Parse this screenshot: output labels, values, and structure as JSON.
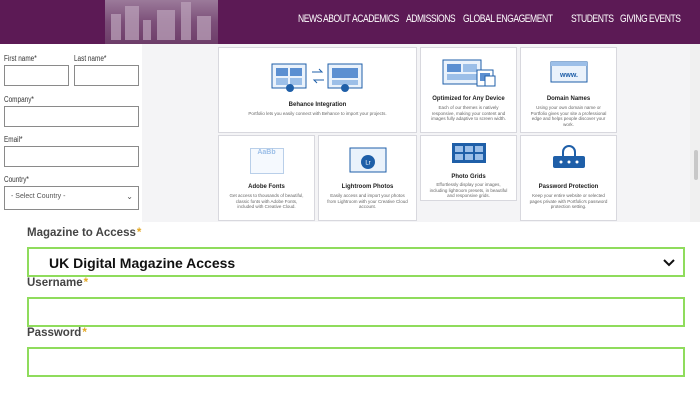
{
  "header": {
    "nav": [
      "NEWS",
      "ABOUT",
      "ACADEMICS",
      "ADMISSIONS",
      "GLOBAL ENGAGEMENT",
      "STUDENTS",
      "GIVING",
      "EVENTS"
    ],
    "bg_color": "#5c1a55"
  },
  "left_form": {
    "first_name_label": "First name*",
    "last_name_label": "Last name*",
    "company_label": "Company*",
    "email_label": "Email*",
    "country_label": "Country*",
    "country_value": "- Select Country -"
  },
  "features": [
    {
      "title": "Behance Integration",
      "desc": "Portfolio lets you easily connect with Behance to import your projects.",
      "icon": "behance-sync-icon"
    },
    {
      "title": "Optimized for Any Device",
      "desc": "Each of our themes is natively responsive, making your content and images fully adaptive to screen width.",
      "icon": "devices-icon"
    },
    {
      "title": "Domain Names",
      "desc": "Using your own domain name or Portfolio gives your site a professional edge and helps people discover your work.",
      "icon": "domain-icon"
    },
    {
      "title": "Adobe Fonts",
      "desc": "Get access to thousands of beautiful, classic fonts with Adobe Fonts, included with Creative Cloud.",
      "icon": "fonts-icon"
    },
    {
      "title": "Lightroom Photos",
      "desc": "Easily access and import your photos from Lightroom with your Creative Cloud account.",
      "icon": "lightroom-icon"
    },
    {
      "title": "Photo Grids",
      "desc": "Effortlessly display your images, including lightroom presets, in beautiful and responsive grids.",
      "icon": "photo-grid-icon"
    },
    {
      "title": "Password Protection",
      "desc": "Keep your entire website or selected pages private with Portfolio's password protection setting.",
      "icon": "lock-icon"
    }
  ],
  "fonts_icon_text": "AaBb",
  "domain_icon_text": "www.",
  "magazine_form": {
    "magazine_label": "Magazine to Access",
    "magazine_value": "UK Digital Magazine Access",
    "username_label": "Username",
    "password_label": "Password",
    "required_mark": "*",
    "focus_color": "#8fdc5c",
    "required_color": "#e3a825"
  }
}
